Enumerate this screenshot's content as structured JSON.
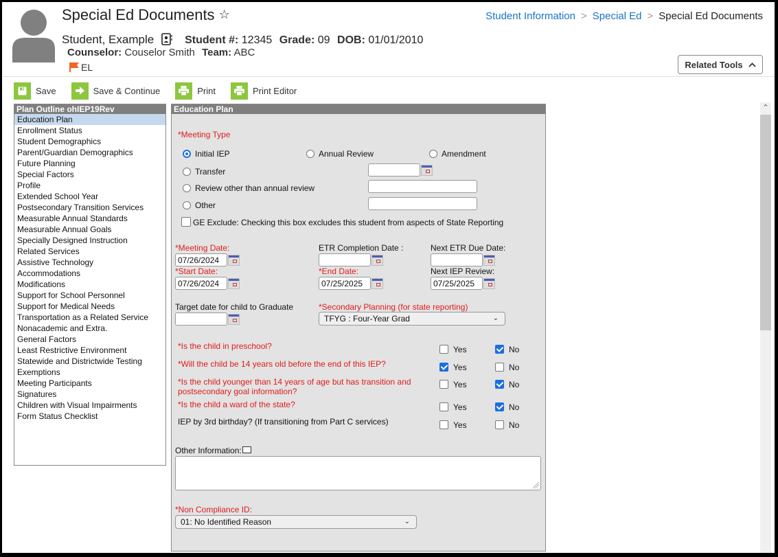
{
  "header": {
    "title": "Special Ed Documents",
    "favorite_icon": "star-outline-icon",
    "student_name": "Student, Example",
    "student_number_label": "Student #:",
    "student_number": "12345",
    "grade_label": "Grade:",
    "grade": "09",
    "dob_label": "DOB:",
    "dob": "01/01/2010",
    "counselor_label": "Counselor:",
    "counselor": "Couselor Smith",
    "team_label": "Team:",
    "team": "ABC",
    "flag_label": "EL",
    "flag_color": "#f26522"
  },
  "breadcrumb": {
    "items": [
      "Student Information",
      "Special Ed"
    ],
    "current": "Special Ed Documents"
  },
  "related_tools": {
    "label": "Related Tools"
  },
  "toolbar": {
    "save": "Save",
    "save_continue": "Save & Continue",
    "print": "Print",
    "print_editor": "Print Editor",
    "accent": "#8dc63f"
  },
  "outline": {
    "title": "Plan Outline ohIEP19Rev",
    "items": [
      "Education Plan",
      "Enrollment Status",
      "Student Demographics",
      "Parent/Guardian Demographics",
      "Future Planning",
      "Special Factors",
      "Profile",
      "Extended School Year",
      "Postsecondary Transition Services",
      "Measurable Annual Standards",
      "Measurable Annual Goals",
      "Specially Designed Instruction",
      "Related Services",
      "Assistive Technology",
      "Accommodations",
      "Modifications",
      "Support for School Personnel",
      "Support for Medical Needs",
      "Transportation as a Related Service",
      "Nonacademic and Extra.",
      "General Factors",
      "Least Restrictive Environment",
      "Statewide and Districtwide Testing",
      "Exemptions",
      "Meeting Participants",
      "Signatures",
      "Children with Visual Impairments",
      "Form Status Checklist"
    ],
    "active_index": 0
  },
  "form": {
    "title": "Education Plan",
    "meeting_type_label": "*Meeting Type",
    "meeting_types": {
      "initial": "Initial IEP",
      "annual": "Annual Review",
      "amendment": "Amendment",
      "transfer": "Transfer",
      "review_other": "Review other than annual review",
      "other": "Other"
    },
    "meeting_type_selected": "Initial IEP",
    "transfer_date": "",
    "review_other_text": "",
    "other_text": "",
    "ge_exclude_label": "GE Exclude: Checking this box excludes this student from aspects of State Reporting",
    "ge_exclude_checked": false,
    "meeting_date_label": "*Meeting Date:",
    "meeting_date": "07/26/2024",
    "etr_completion_label": "ETR Completion Date :",
    "etr_completion": "",
    "next_etr_label": "Next ETR Due Date:",
    "next_etr": "",
    "start_date_label": "*Start Date:",
    "start_date": "07/26/2024",
    "end_date_label": "*End Date:",
    "end_date": "07/25/2025",
    "next_iep_label": "Next IEP Review:",
    "next_iep": "07/25/2025",
    "target_grad_label": "Target date for child to Graduate",
    "target_grad": "",
    "secondary_planning_label": "*Secondary Planning (for state reporting)",
    "secondary_planning": "TFYG : Four-Year Grad",
    "questions": [
      {
        "text": "*Is the child in preschool?",
        "required": true,
        "yes": false,
        "no": true
      },
      {
        "text": "*Will the child be 14 years old before the end of this IEP?",
        "required": true,
        "yes": true,
        "no": false
      },
      {
        "text": "*Is the child younger than 14 years of age but has transition and",
        "text2": "postsecondary goal information?",
        "required": true,
        "yes": false,
        "no": true
      },
      {
        "text": "*Is the child a ward of the state?",
        "required": true,
        "yes": false,
        "no": true
      },
      {
        "text": "IEP by 3rd birthday? (If transitioning from Part C services)",
        "required": false,
        "yes": false,
        "no": false
      }
    ],
    "yes_label": "Yes",
    "no_label": "No",
    "other_info_label": "Other Information:",
    "other_info": "",
    "non_compliance_label": "*Non Compliance ID:",
    "non_compliance": "01: No Identified Reason",
    "required_color": "#e01b1b",
    "checked_color": "#1a6fe0"
  }
}
